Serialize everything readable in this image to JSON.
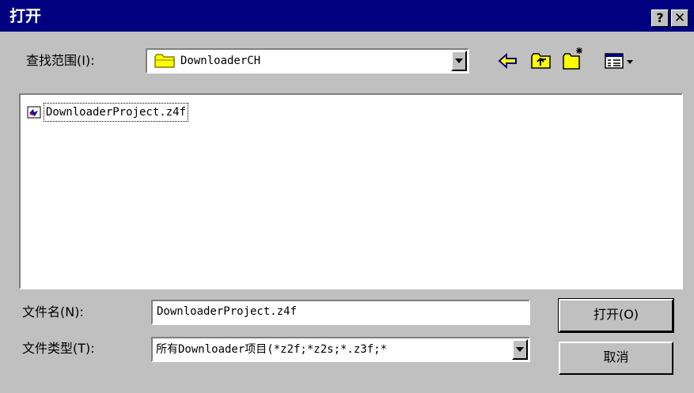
{
  "window": {
    "title": "打开",
    "help_label": "?",
    "close_label": "✕"
  },
  "lookin": {
    "label": "查找范围(I):",
    "value": "DownloaderCH"
  },
  "files": [
    {
      "name": "DownloaderProject.z4f",
      "icon": "project-file-icon"
    }
  ],
  "filename": {
    "label": "文件名(N):",
    "value": "DownloaderProject.z4f"
  },
  "filetype": {
    "label": "文件类型(T):",
    "value": "所有Downloader项目(*z2f;*z2s;*.z3f;*"
  },
  "buttons": {
    "open": "打开(O)",
    "cancel": "取消"
  },
  "colors": {
    "titlebar": "#000080",
    "face": "#c0c0c0",
    "folder": "#ffff00"
  }
}
